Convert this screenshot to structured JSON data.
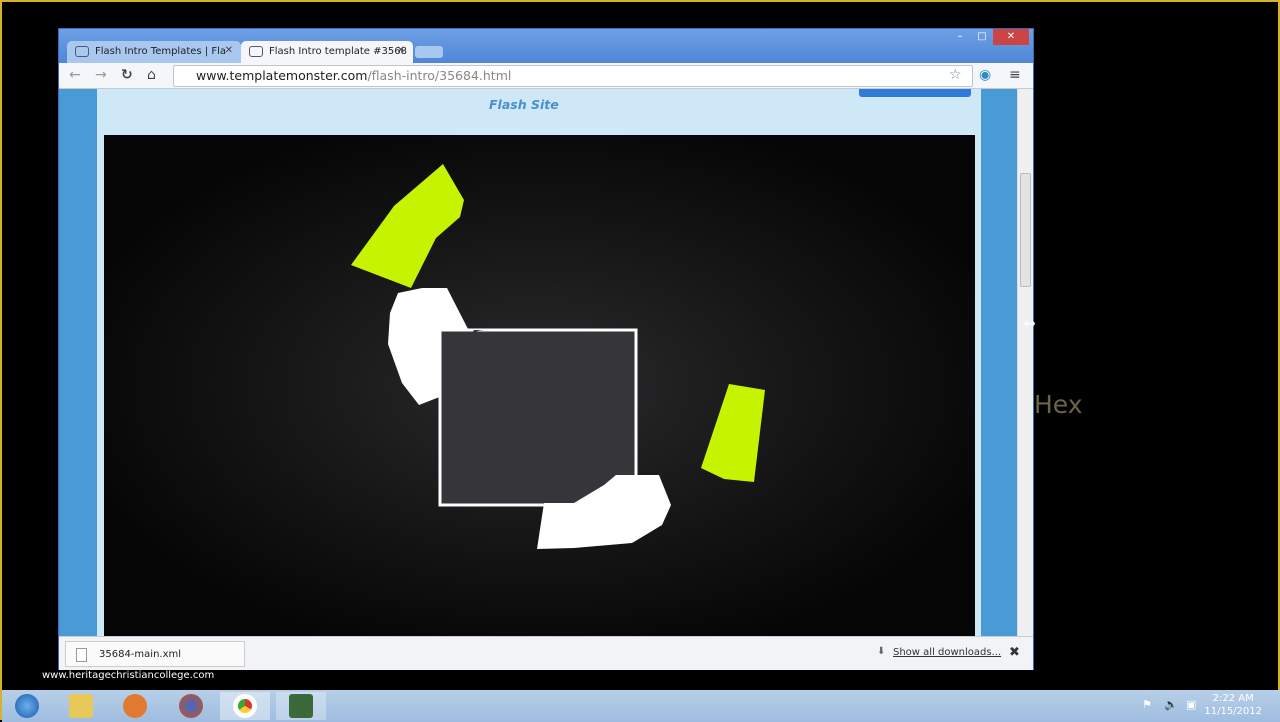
{
  "browser": {
    "tabs": [
      {
        "label": "Flash Intro Templates | Fla",
        "active": false
      },
      {
        "label": "Flash Intro template #3568",
        "active": true
      }
    ],
    "url_host": "www.templatemonster.com",
    "url_path": "/flash-intro/35684.html",
    "window_controls": [
      "–",
      "□",
      "✕"
    ]
  },
  "page": {
    "flash_title": "Flash Site"
  },
  "downloads": {
    "item": "35684-main.xml",
    "show_all": "Show all downloads...",
    "close": "✖"
  },
  "desktop": {
    "watermark": "www.heritagechristiancollege.com",
    "overlay_text": "Hex"
  },
  "taskbar": {
    "time": "2:22 AM",
    "date": "11/15/2012",
    "apps": [
      "start",
      "explorer",
      "media-player",
      "firefox",
      "chrome",
      "app"
    ]
  },
  "colors": {
    "accent_green": "#c6f400",
    "page_blue": "#4a9ad6"
  }
}
